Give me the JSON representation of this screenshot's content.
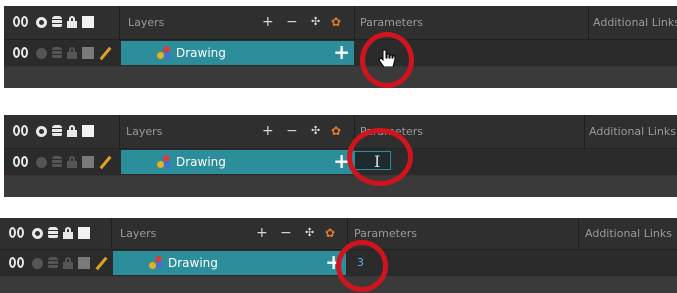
{
  "panels": [
    {
      "header": {
        "layers_label": "Layers",
        "parameters_label": "Parameters",
        "additional_links_label": "Additional Links"
      },
      "layer": {
        "name": "Drawing",
        "parameter_value": ""
      },
      "state": "hover-pointer"
    },
    {
      "header": {
        "layers_label": "Layers",
        "parameters_label": "Parameters",
        "additional_links_label": "Additional Links"
      },
      "layer": {
        "name": "Drawing",
        "parameter_value": ""
      },
      "state": "editing-field"
    },
    {
      "header": {
        "layers_label": "Layers",
        "parameters_label": "Parameters",
        "additional_links_label": "Additional Links"
      },
      "layer": {
        "name": "Drawing",
        "parameter_value": "3"
      },
      "state": "value-entered"
    }
  ],
  "colors": {
    "accent": "#2d8e9b",
    "highlight_ring": "#d0141e",
    "panel_bg": "#363636",
    "value_text": "#5ab4ff"
  },
  "icons": [
    "eyes-icon",
    "circle-icon",
    "database-icon",
    "lock-icon",
    "square-icon",
    "pencil-icon",
    "add-layer-icon",
    "remove-layer-icon",
    "add-peg-icon",
    "layer-properties-icon",
    "drawing-layer-icon",
    "hand-pointer-icon",
    "text-cursor-icon"
  ]
}
